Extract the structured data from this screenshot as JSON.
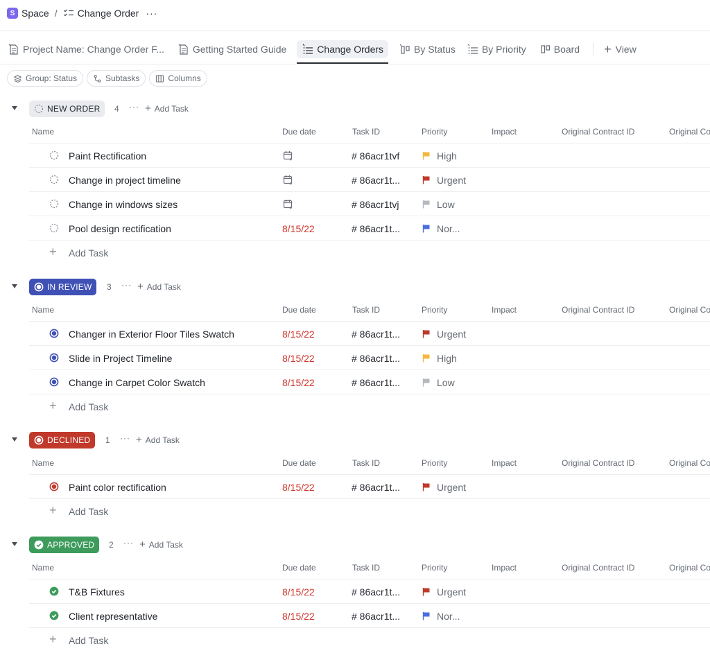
{
  "breadcrumb": {
    "space_badge": "S",
    "space": "Space",
    "separator": "/",
    "current": "Change Order",
    "more": "···"
  },
  "tabs": [
    {
      "label": "Project Name: Change Order F...",
      "icon": "doc-icon"
    },
    {
      "label": "Getting Started Guide",
      "icon": "doc-icon"
    },
    {
      "label": "Change Orders",
      "icon": "list-icon",
      "active": true
    },
    {
      "label": "By Status",
      "icon": "board-icon"
    },
    {
      "label": "By Priority",
      "icon": "list-icon"
    },
    {
      "label": "Board",
      "icon": "board-icon"
    },
    {
      "label": "View",
      "icon": "plus-icon"
    }
  ],
  "chips": {
    "group": "Group: Status",
    "subtasks": "Subtasks",
    "columns": "Columns"
  },
  "columns": {
    "name": "Name",
    "due": "Due date",
    "taskid": "Task ID",
    "priority": "Priority",
    "impact": "Impact",
    "contract": "Original Contract ID",
    "original_cut": "Original Co"
  },
  "add_task": "Add Task",
  "more": "···",
  "colors": {
    "new_order_bg": "#e9ebee",
    "in_review": "#3f51b5",
    "declined": "#c0392b",
    "approved": "#3d9b5c",
    "due_red": "#d0342c",
    "flag_high": "#f5b83d",
    "flag_urgent": "#c0392b",
    "flag_low": "#b4b8bf",
    "flag_normal": "#4a6ee0"
  },
  "groups": [
    {
      "status": "NEW ORDER",
      "count": "4",
      "tasks": [
        {
          "name": "Paint Rectification",
          "due": "",
          "taskid": "# 86acr1tvf",
          "priority": "High",
          "flag": "high"
        },
        {
          "name": "Change in project timeline",
          "due": "",
          "taskid": "# 86acr1t...",
          "priority": "Urgent",
          "flag": "urgent"
        },
        {
          "name": "Change in windows sizes",
          "due": "",
          "taskid": "# 86acr1tvj",
          "priority": "Low",
          "flag": "low"
        },
        {
          "name": "Pool design rectification",
          "due": "8/15/22",
          "taskid": "# 86acr1t...",
          "priority": "Nor...",
          "flag": "normal"
        }
      ]
    },
    {
      "status": "IN REVIEW",
      "count": "3",
      "tasks": [
        {
          "name": "Changer in Exterior Floor Tiles Swatch",
          "due": "8/15/22",
          "taskid": "# 86acr1t...",
          "priority": "Urgent",
          "flag": "urgent"
        },
        {
          "name": "Slide in Project Timeline",
          "due": "8/15/22",
          "taskid": "# 86acr1t...",
          "priority": "High",
          "flag": "high"
        },
        {
          "name": "Change in Carpet Color Swatch",
          "due": "8/15/22",
          "taskid": "# 86acr1t...",
          "priority": "Low",
          "flag": "low"
        }
      ]
    },
    {
      "status": "DECLINED",
      "count": "1",
      "tasks": [
        {
          "name": "Paint color rectification",
          "due": "8/15/22",
          "taskid": "# 86acr1t...",
          "priority": "Urgent",
          "flag": "urgent"
        }
      ]
    },
    {
      "status": "APPROVED",
      "count": "2",
      "tasks": [
        {
          "name": "T&B Fixtures",
          "due": "8/15/22",
          "taskid": "# 86acr1t...",
          "priority": "Urgent",
          "flag": "urgent"
        },
        {
          "name": "Client representative",
          "due": "8/15/22",
          "taskid": "# 86acr1t...",
          "priority": "Nor...",
          "flag": "normal"
        }
      ]
    }
  ]
}
